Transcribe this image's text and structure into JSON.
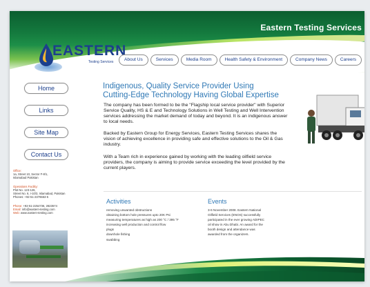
{
  "header": {
    "site_title": "Eastern Testing Services",
    "logo_word": "EASTERN",
    "logo_sub": "Testing Services"
  },
  "nav": [
    {
      "label": "About Us"
    },
    {
      "label": "Services"
    },
    {
      "label": "Media Room"
    },
    {
      "label": "Health Safety & Environment"
    },
    {
      "label": "Company News"
    },
    {
      "label": "Careers"
    }
  ],
  "sidebar": {
    "buttons": [
      {
        "label": "Home"
      },
      {
        "label": "Links"
      },
      {
        "label": "Site Map"
      },
      {
        "label": "Contact Us"
      }
    ],
    "office_label": "Office:",
    "office_lines": [
      "1a, Street 10, Sector F-8/1,",
      "Islamabad Pakistan"
    ],
    "facility_label": "Operations Facility:",
    "facility_lines": [
      "Plot No. 123-126,",
      "Street No. 6, I-10/3, Islamabad, Pakistan",
      "Phones: +92-51-2376553-5"
    ],
    "phone_label": "Phone:",
    "phone": "+92-51-2254736, 2823574",
    "email_label": "Email:",
    "email": "info@eastern-testing.com",
    "web_label": "Web:",
    "web": "www.eastern-testing.com"
  },
  "main": {
    "headline_line1": "Indigenous, Quality Service Provider Using",
    "headline_line2": "Cutting-Edge Technology Having Global Expertise",
    "para1": "The company has been formed to be the \"Flagship local service provider\" with Superior Service Quality, HS & E and Technology Solutions in Well Testing and Well Intervention services addressing the market demand of today and beyond. It is an indigenous answer to local needs.",
    "para2": "Backed by Eastern Group for Energy Services, Eastern Testing Services shares the vision of achieving excellence in providing safe and effective solutions to the Oil & Gas industry.",
    "para3": "With a Team rich in experience gained by working with the leading oilfield service providers, the company is aiming to provide service exceeding the level provided by the current players."
  },
  "activities": {
    "title": "Activities",
    "items": [
      "removing unwanted obstructions",
      "obtaining bottom hole pressures upto 20K Psi",
      "measuring temperatures as high as 200 °C / 395 °F",
      "increasing well production and control flow",
      "plugs",
      "downhole fishing",
      "swabbing"
    ]
  },
  "events": {
    "title": "Events",
    "lines": [
      "3-6 November 2008. Eastern National",
      "Oilfield Services (ENOS) successfully",
      "participated in the ever growing ADIPEC",
      "oil show in Abu Dhabi. An award for the",
      "booth design and attendance was",
      "awarded from the organizers."
    ]
  }
}
